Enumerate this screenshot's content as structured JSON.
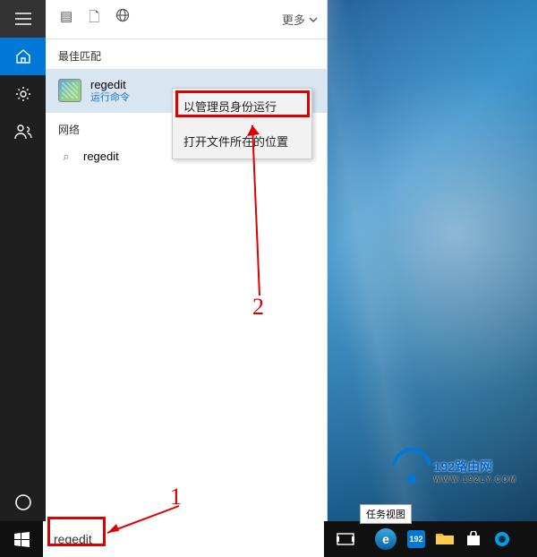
{
  "sidebar": {
    "items": [
      {
        "name": "menu-icon"
      },
      {
        "name": "home-icon"
      },
      {
        "name": "settings-icon"
      },
      {
        "name": "person-icon"
      }
    ]
  },
  "top": {
    "more_label": "更多"
  },
  "sections": {
    "best_match": "最佳匹配",
    "network": "网络"
  },
  "results": {
    "best": {
      "name": "regedit",
      "sub": "运行命令"
    },
    "net": {
      "name": "regedit"
    }
  },
  "context_menu": {
    "run_as_admin": "以管理员身份运行",
    "open_location": "打开文件所在的位置"
  },
  "annotations": {
    "one": "1",
    "two": "2"
  },
  "tooltip": "任务视图",
  "watermark": {
    "title": "192路由网",
    "sub": "WWW.192LY.COM"
  },
  "search": {
    "value": "regedit"
  },
  "tray": {
    "badge": "192"
  }
}
